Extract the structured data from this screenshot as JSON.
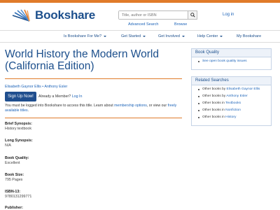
{
  "header": {
    "logo_text": "Bookshare",
    "search_placeholder": "Title, author or ISBN",
    "login_label": "Log in",
    "advanced_search_label": "Advanced Search",
    "browse_label": "Browse",
    "accent_color": "#e07b2a",
    "brand_color": "#1c4f8c",
    "search_icon": "search-icon"
  },
  "nav": {
    "items": [
      {
        "label": "Is Bookshare For Me?"
      },
      {
        "label": "Get Started"
      },
      {
        "label": "Get Involved"
      },
      {
        "label": "Help Center"
      },
      {
        "label": "My Bookshare"
      }
    ]
  },
  "book": {
    "title": "World History the Modern World (California Edition)",
    "author_1": "Elisabeth Gaynor Ellis",
    "author_sep": " • ",
    "author_2": "Anthony Esler",
    "signup_label": "Sign Up Now!",
    "member_text": "Already a Member?",
    "member_login": "Log In",
    "notice_prefix": "You must be logged into Bookshare to access this title. Learn about ",
    "notice_link_1": "membership options",
    "notice_middle": ", or view our ",
    "notice_link_2": "freely available titles",
    "notice_suffix": ".",
    "fields": [
      {
        "label": "Brief Synopsis:",
        "value": "History textbook"
      },
      {
        "label": "Long Synopsis:",
        "value": "N/A"
      },
      {
        "label": "Book Quality:",
        "value": "Excellent"
      },
      {
        "label": "Book Size:",
        "value": "795 Pages"
      },
      {
        "label": "ISBN-13:",
        "value": "9780131299771"
      },
      {
        "label": "Publisher:",
        "value": ""
      }
    ]
  },
  "sidebar": {
    "quality_title": "Book Quality",
    "quality_link": "See open book quality issues",
    "related_title": "Related Searches",
    "related": [
      {
        "prefix": "Other books by ",
        "link": "Elisabeth Gaynor Ellis"
      },
      {
        "prefix": "Other books by ",
        "link": "Anthony Esler"
      },
      {
        "prefix": "Other books in ",
        "link": "Textbooks"
      },
      {
        "prefix": "Other books in ",
        "link": "Nonfiction"
      },
      {
        "prefix": "Other books in ",
        "link": "History"
      }
    ]
  }
}
